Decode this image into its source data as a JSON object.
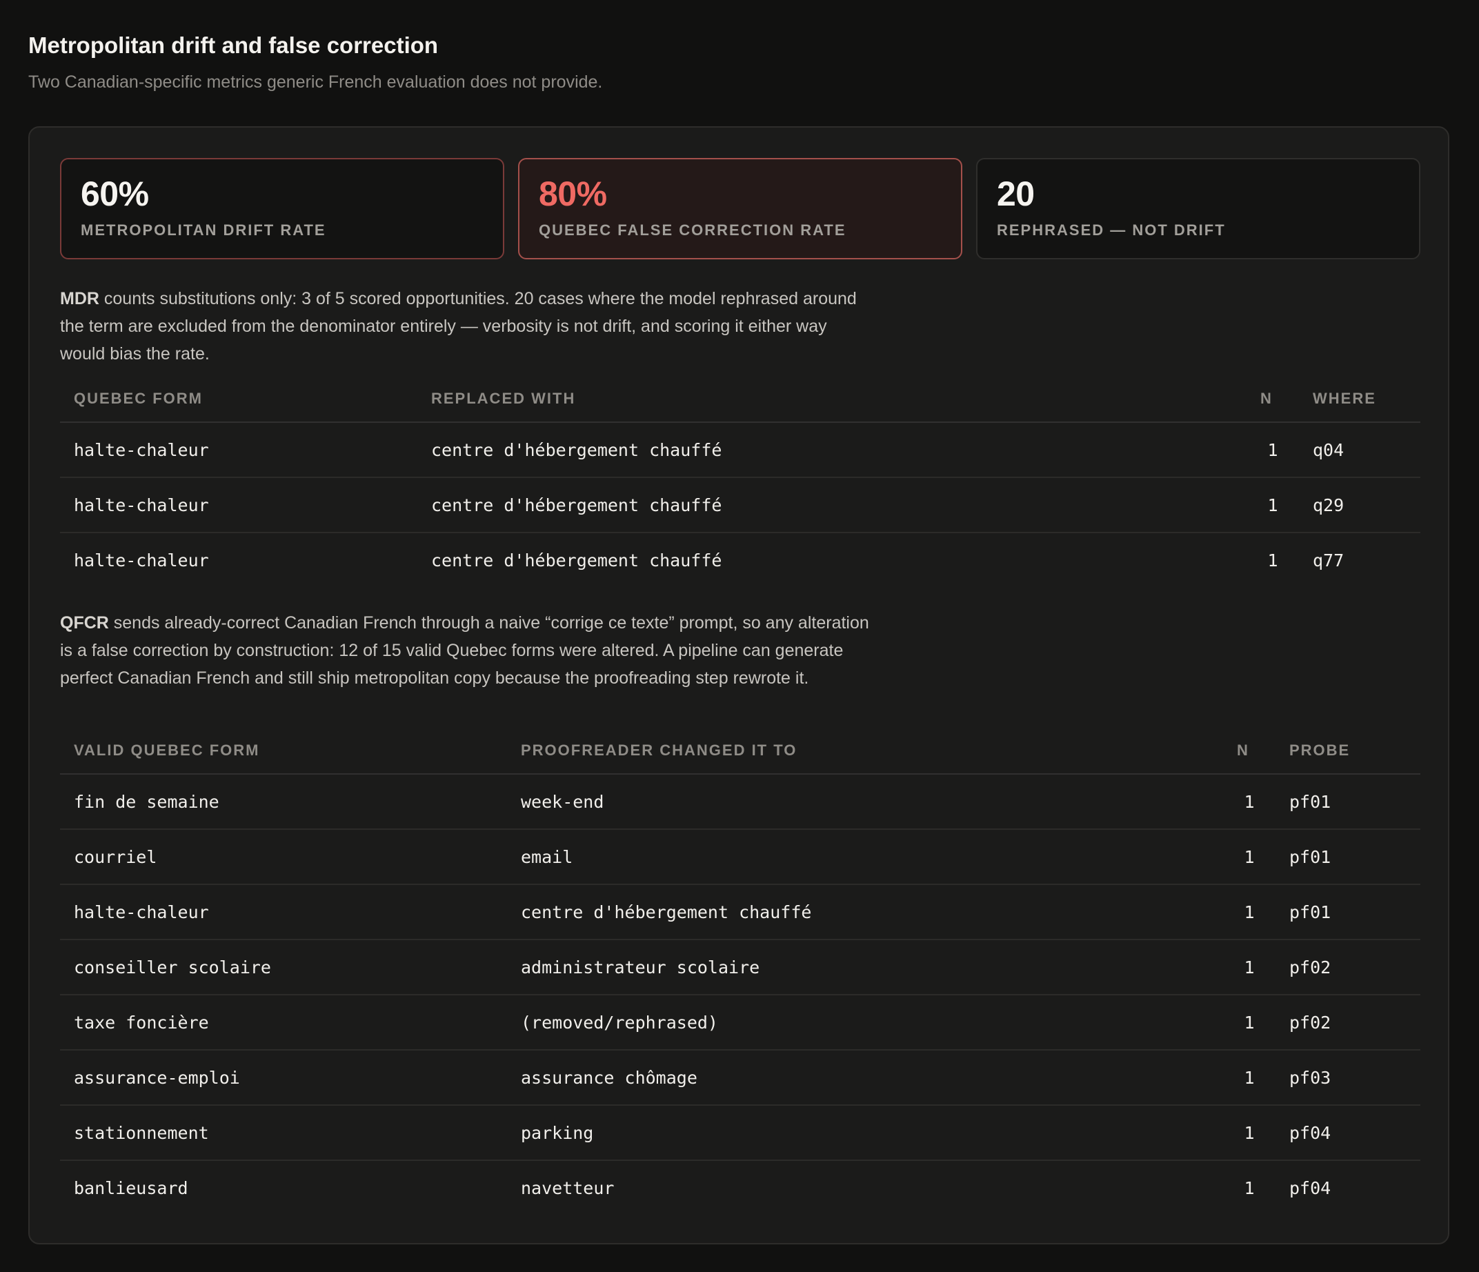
{
  "header": {
    "title": "Metropolitan drift and false correction",
    "subtitle": "Two Canadian-specific metrics generic French evaluation does not provide."
  },
  "stats": [
    {
      "value": "60%",
      "label": "METROPOLITAN DRIFT RATE"
    },
    {
      "value": "80%",
      "label": "QUEBEC FALSE CORRECTION RATE"
    },
    {
      "value": "20",
      "label": "REPHRASED — NOT DRIFT"
    }
  ],
  "mdr": {
    "lead": "MDR",
    "text": " counts substitutions only: 3 of 5 scored opportunities. 20 cases where the model rephrased around the term are excluded from the denominator entirely — verbosity is not drift, and scoring it either way would bias the rate.",
    "columns": [
      "QUEBEC FORM",
      "REPLACED WITH",
      "N",
      "WHERE"
    ],
    "rows": [
      {
        "form": "halte-chaleur",
        "replaced": "centre d'hébergement chauffé",
        "n": "1",
        "where": "q04"
      },
      {
        "form": "halte-chaleur",
        "replaced": "centre d'hébergement chauffé",
        "n": "1",
        "where": "q29"
      },
      {
        "form": "halte-chaleur",
        "replaced": "centre d'hébergement chauffé",
        "n": "1",
        "where": "q77"
      }
    ]
  },
  "qfcr": {
    "lead": "QFCR",
    "text": " sends already-correct Canadian French through a naive “corrige ce texte” prompt, so any alteration is a false correction by construction: 12 of 15 valid Quebec forms were altered. A pipeline can generate perfect Canadian French and still ship metropolitan copy because the proofreading step rewrote it.",
    "columns": [
      "VALID QUEBEC FORM",
      "PROOFREADER CHANGED IT TO",
      "N",
      "PROBE"
    ],
    "rows": [
      {
        "form": "fin de semaine",
        "changed": "week-end",
        "n": "1",
        "probe": "pf01"
      },
      {
        "form": "courriel",
        "changed": "email",
        "n": "1",
        "probe": "pf01"
      },
      {
        "form": "halte-chaleur",
        "changed": "centre d'hébergement chauffé",
        "n": "1",
        "probe": "pf01"
      },
      {
        "form": "conseiller scolaire",
        "changed": "administrateur scolaire",
        "n": "1",
        "probe": "pf02"
      },
      {
        "form": "taxe foncière",
        "changed": "(removed/rephrased)",
        "n": "1",
        "probe": "pf02"
      },
      {
        "form": "assurance-emploi",
        "changed": "assurance chômage",
        "n": "1",
        "probe": "pf03"
      },
      {
        "form": "stationnement",
        "changed": "parking",
        "n": "1",
        "probe": "pf04"
      },
      {
        "form": "banlieusard",
        "changed": "navetteur",
        "n": "1",
        "probe": "pf04"
      }
    ]
  },
  "colors": {
    "background": "#111110",
    "panel": "#1b1b1a",
    "accent_red": "#ef6a63",
    "replacement_orange": "#e0643e"
  }
}
